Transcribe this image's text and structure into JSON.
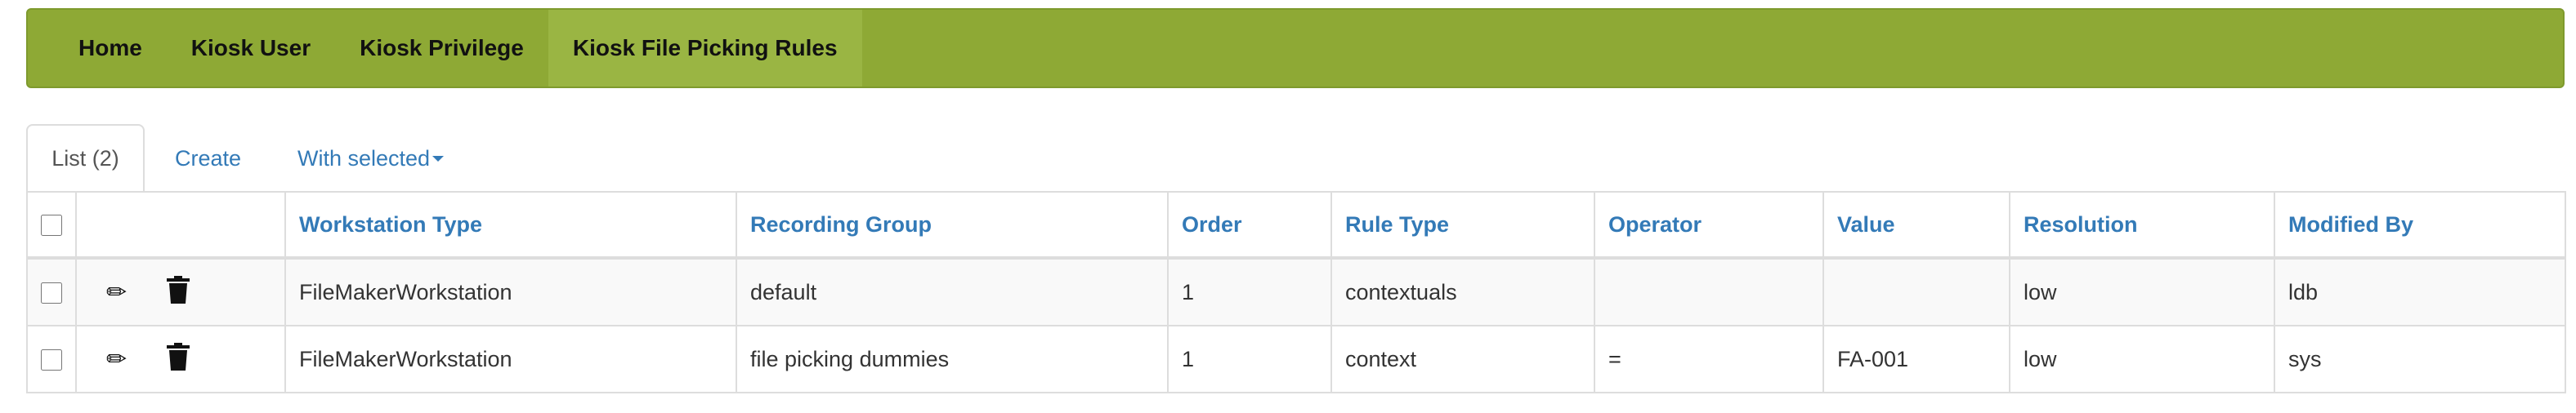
{
  "navbar": {
    "items": [
      {
        "label": "Home"
      },
      {
        "label": "Kiosk User"
      },
      {
        "label": "Kiosk Privilege"
      },
      {
        "label": "Kiosk File Picking Rules"
      }
    ],
    "active_index": 3,
    "background_color": "#8ea935"
  },
  "tabs": {
    "list_label": "List (2)",
    "create_label": "Create",
    "with_selected_label": "With selected"
  },
  "table": {
    "columns": [
      "Workstation Type",
      "Recording Group",
      "Order",
      "Rule Type",
      "Operator",
      "Value",
      "Resolution",
      "Modified By"
    ],
    "rows": [
      {
        "workstation_type": "FileMakerWorkstation",
        "recording_group": "default",
        "order": "1",
        "rule_type": "contextuals",
        "operator": "",
        "value": "",
        "resolution": "low",
        "modified_by": "ldb"
      },
      {
        "workstation_type": "FileMakerWorkstation",
        "recording_group": "file picking dummies",
        "order": "1",
        "rule_type": "context",
        "operator": "=",
        "value": "FA-001",
        "resolution": "low",
        "modified_by": "sys"
      }
    ],
    "row_actions": {
      "edit_icon": "pencil-icon",
      "delete_icon": "trash-icon"
    },
    "header_color": "#337ab7"
  }
}
